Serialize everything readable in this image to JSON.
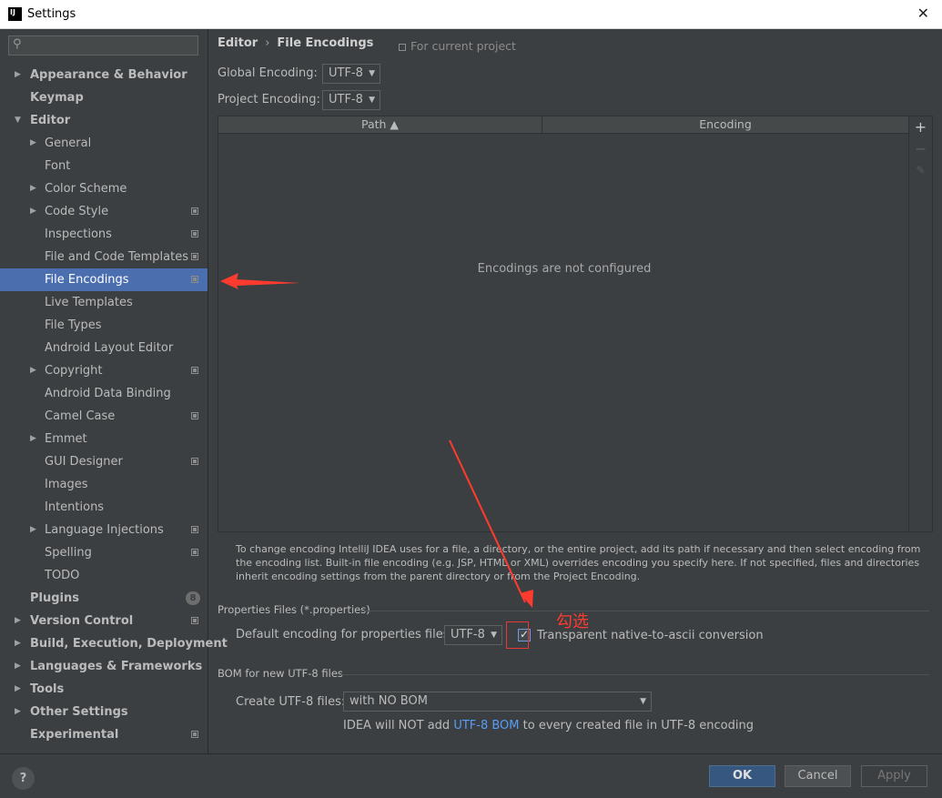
{
  "window": {
    "title": "Settings",
    "icon_text": "IJ",
    "close_glyph": "✕"
  },
  "sidebar": {
    "search_placeholder": "",
    "items": [
      {
        "label": "Appearance & Behavior",
        "level": 0,
        "arrow": "▶"
      },
      {
        "label": "Keymap",
        "level": 0
      },
      {
        "label": "Editor",
        "level": 0,
        "arrow": "▼"
      },
      {
        "label": "General",
        "level": 1,
        "arrow": "▶"
      },
      {
        "label": "Font",
        "level": 1
      },
      {
        "label": "Color Scheme",
        "level": 1,
        "arrow": "▶"
      },
      {
        "label": "Code Style",
        "level": 1,
        "arrow": "▶",
        "project": true
      },
      {
        "label": "Inspections",
        "level": 1,
        "project": true
      },
      {
        "label": "File and Code Templates",
        "level": 1,
        "project": true
      },
      {
        "label": "File Encodings",
        "level": 1,
        "project": true,
        "selected": true
      },
      {
        "label": "Live Templates",
        "level": 1
      },
      {
        "label": "File Types",
        "level": 1
      },
      {
        "label": "Android Layout Editor",
        "level": 1
      },
      {
        "label": "Copyright",
        "level": 1,
        "arrow": "▶",
        "project": true
      },
      {
        "label": "Android Data Binding",
        "level": 1
      },
      {
        "label": "Camel Case",
        "level": 1,
        "project": true
      },
      {
        "label": "Emmet",
        "level": 1,
        "arrow": "▶"
      },
      {
        "label": "GUI Designer",
        "level": 1,
        "project": true
      },
      {
        "label": "Images",
        "level": 1
      },
      {
        "label": "Intentions",
        "level": 1
      },
      {
        "label": "Language Injections",
        "level": 1,
        "arrow": "▶",
        "project": true
      },
      {
        "label": "Spelling",
        "level": 1,
        "project": true
      },
      {
        "label": "TODO",
        "level": 1
      },
      {
        "label": "Plugins",
        "level": 0,
        "badge": "8"
      },
      {
        "label": "Version Control",
        "level": 0,
        "arrow": "▶",
        "project": true
      },
      {
        "label": "Build, Execution, Deployment",
        "level": 0,
        "arrow": "▶"
      },
      {
        "label": "Languages & Frameworks",
        "level": 0,
        "arrow": "▶"
      },
      {
        "label": "Tools",
        "level": 0,
        "arrow": "▶"
      },
      {
        "label": "Other Settings",
        "level": 0,
        "arrow": "▶"
      },
      {
        "label": "Experimental",
        "level": 0,
        "project": true
      }
    ]
  },
  "content": {
    "breadcrumb": {
      "parent": "Editor",
      "separator": "›",
      "current": "File Encodings"
    },
    "for_current_project": "For current project",
    "global_encoding": {
      "label": "Global Encoding:",
      "value": "UTF-8"
    },
    "project_encoding": {
      "label": "Project Encoding:",
      "value": "UTF-8"
    },
    "table": {
      "columns": {
        "path": "Path ▲",
        "encoding": "Encoding"
      },
      "empty_text": "Encodings are not configured",
      "tools": {
        "add": "+",
        "remove": "−",
        "edit": "✎"
      }
    },
    "help_text": "To change encoding IntelliJ IDEA uses for a file, a directory, or the entire project, add its path if necessary and then select encoding from the encoding list. Built-in file encoding (e.g. JSP, HTML or XML) overrides encoding you specify here. If not specified, files and directories inherit encoding settings from the parent directory or from the Project Encoding.",
    "properties": {
      "section_title": "Properties Files (*.properties)",
      "default_label": "Default encoding for properties files:",
      "default_value": "UTF-8",
      "transparent_label": "Transparent native-to-ascii conversion",
      "transparent_checked": true,
      "checkmark": "✓"
    },
    "bom": {
      "section_title": "BOM for new UTF-8 files",
      "create_label": "Create UTF-8 files:",
      "create_value": "with NO BOM",
      "note_before": "IDEA will NOT add ",
      "note_link": "UTF-8 BOM",
      "note_after": " to every created file in UTF-8 encoding"
    },
    "annotation": "勾选"
  },
  "footer": {
    "help": "?",
    "ok": "OK",
    "cancel": "Cancel",
    "apply": "Apply"
  },
  "colors": {
    "selection": "#4b6eaf",
    "background": "#3c3f41",
    "link": "#589df6",
    "annotation_red": "#ff3b30",
    "ok_button": "#365880"
  }
}
